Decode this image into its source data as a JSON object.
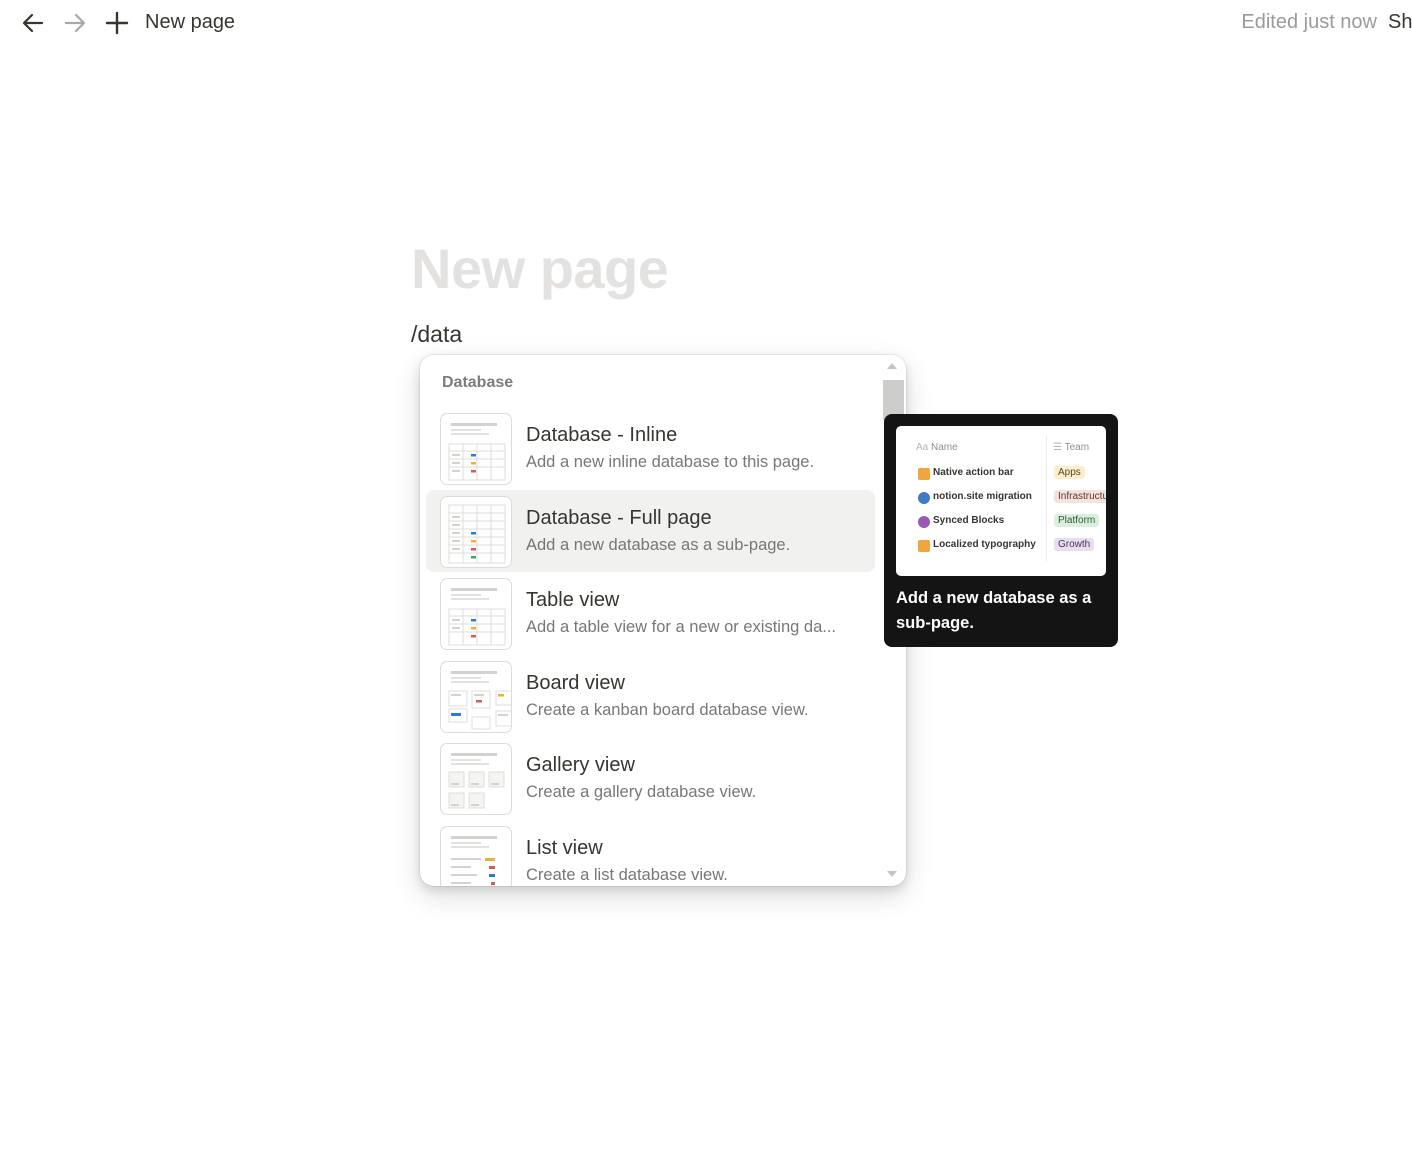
{
  "topbar": {
    "title": "New page",
    "edited": "Edited just now",
    "share": "Share",
    "icons": [
      "arrow-left-icon",
      "arrow-right-icon",
      "plus-icon"
    ]
  },
  "page": {
    "heading_placeholder": "New page",
    "slash_command": "/data"
  },
  "menu": {
    "section": "Database",
    "items": [
      {
        "title": "Database - Inline",
        "desc": "Add a new inline database to this page.",
        "selected": false
      },
      {
        "title": "Database - Full page",
        "desc": "Add a new database as a sub-page.",
        "selected": true
      },
      {
        "title": "Table view",
        "desc": "Add a table view for a new or existing da...",
        "selected": false
      },
      {
        "title": "Board view",
        "desc": "Create a kanban board database view.",
        "selected": false
      },
      {
        "title": "Gallery view",
        "desc": "Create a gallery database view.",
        "selected": false
      },
      {
        "title": "List view",
        "desc": "Create a list database view.",
        "selected": false
      }
    ]
  },
  "preview": {
    "col_name": "Name",
    "col_team": "Team",
    "rows": [
      {
        "name": "Native action bar",
        "team": "Apps",
        "emoji_color": "#f0a63c",
        "tag_bg": "#fbeecc",
        "tag_fg": "#5b4a1e"
      },
      {
        "name": "notion.site migration",
        "team": "Infrastructure",
        "emoji_color": "#3f7ac4",
        "tag_bg": "#f4e3dc",
        "tag_fg": "#5a3b2e"
      },
      {
        "name": "Synced Blocks",
        "team": "Platform",
        "emoji_color": "#9b59b6",
        "tag_bg": "#dcefdd",
        "tag_fg": "#2c5b34"
      },
      {
        "name": "Localized typography",
        "team": "Growth",
        "emoji_color": "#f0a63c",
        "tag_bg": "#e8deee",
        "tag_fg": "#4b3565"
      }
    ],
    "caption": "Add a new database as a sub-page."
  }
}
